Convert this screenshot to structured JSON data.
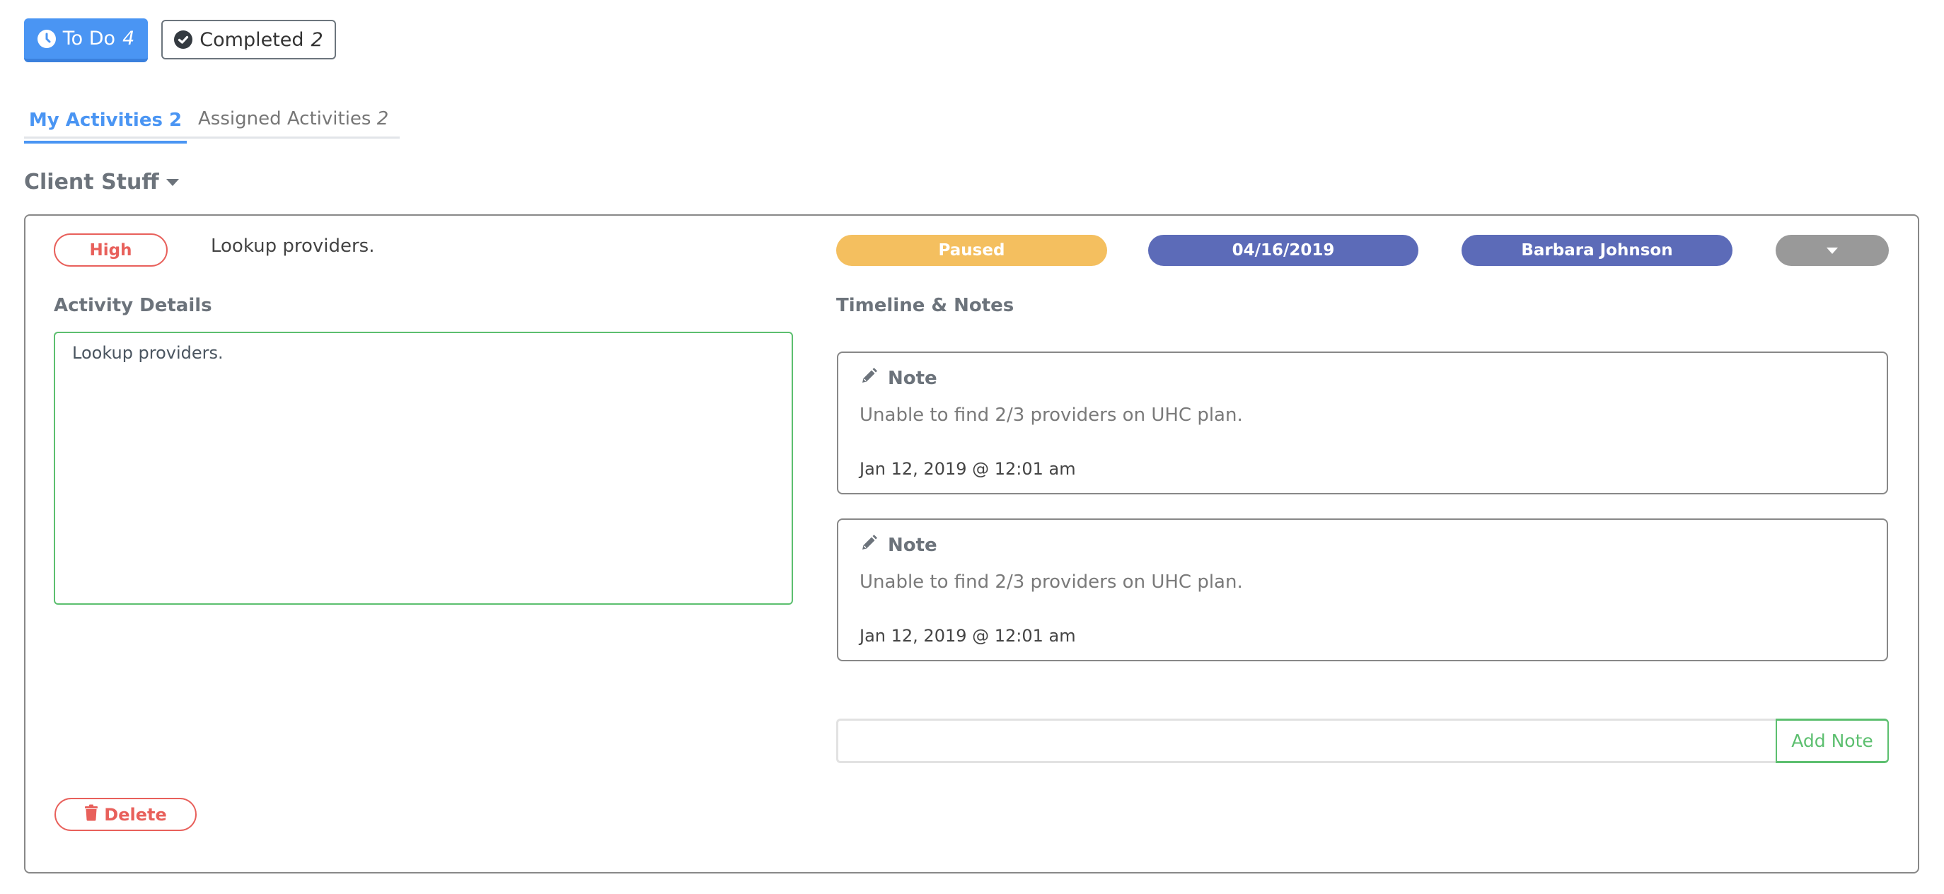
{
  "top_toggle": {
    "todo": {
      "label": "To Do",
      "count": "4",
      "icon": "clock-icon"
    },
    "completed": {
      "label": "Completed",
      "count": "2",
      "icon": "check-circle-icon"
    }
  },
  "tabs": [
    {
      "label": "My Activities",
      "count": "2",
      "active": true
    },
    {
      "label": "Assigned Activities",
      "count": "2",
      "active": false
    }
  ],
  "group": {
    "title": "Client Stuff",
    "icon": "caret-down-icon"
  },
  "activity": {
    "priority": "High",
    "title": "Lookup providers.",
    "status": "Paused",
    "due_date": "04/16/2019",
    "assignee": "Barbara Johnson",
    "more_icon": "caret-down-icon",
    "details_heading": "Activity Details",
    "details_text": "Lookup providers.",
    "timeline_heading": "Timeline & Notes",
    "notes": [
      {
        "icon": "pencil-icon",
        "title": "Note",
        "body": "Unable to find 2/3 providers on UHC plan.",
        "date": "Jan 12, 2019 @ 12:01 am"
      },
      {
        "icon": "pencil-icon",
        "title": "Note",
        "body": "Unable to find 2/3 providers on UHC plan.",
        "date": "Jan 12, 2019 @ 12:01 am"
      }
    ],
    "note_input": {
      "value": "",
      "placeholder": ""
    },
    "add_note_label": "Add Note",
    "delete_label": "Delete",
    "delete_icon": "trash-icon"
  },
  "colors": {
    "primary": "#4a95f3",
    "priority_high": "#e8605b",
    "status_paused": "#f4bf5f",
    "badge_indigo": "#5c6bb8",
    "badge_gray": "#999999",
    "success": "#5cbf6f"
  }
}
